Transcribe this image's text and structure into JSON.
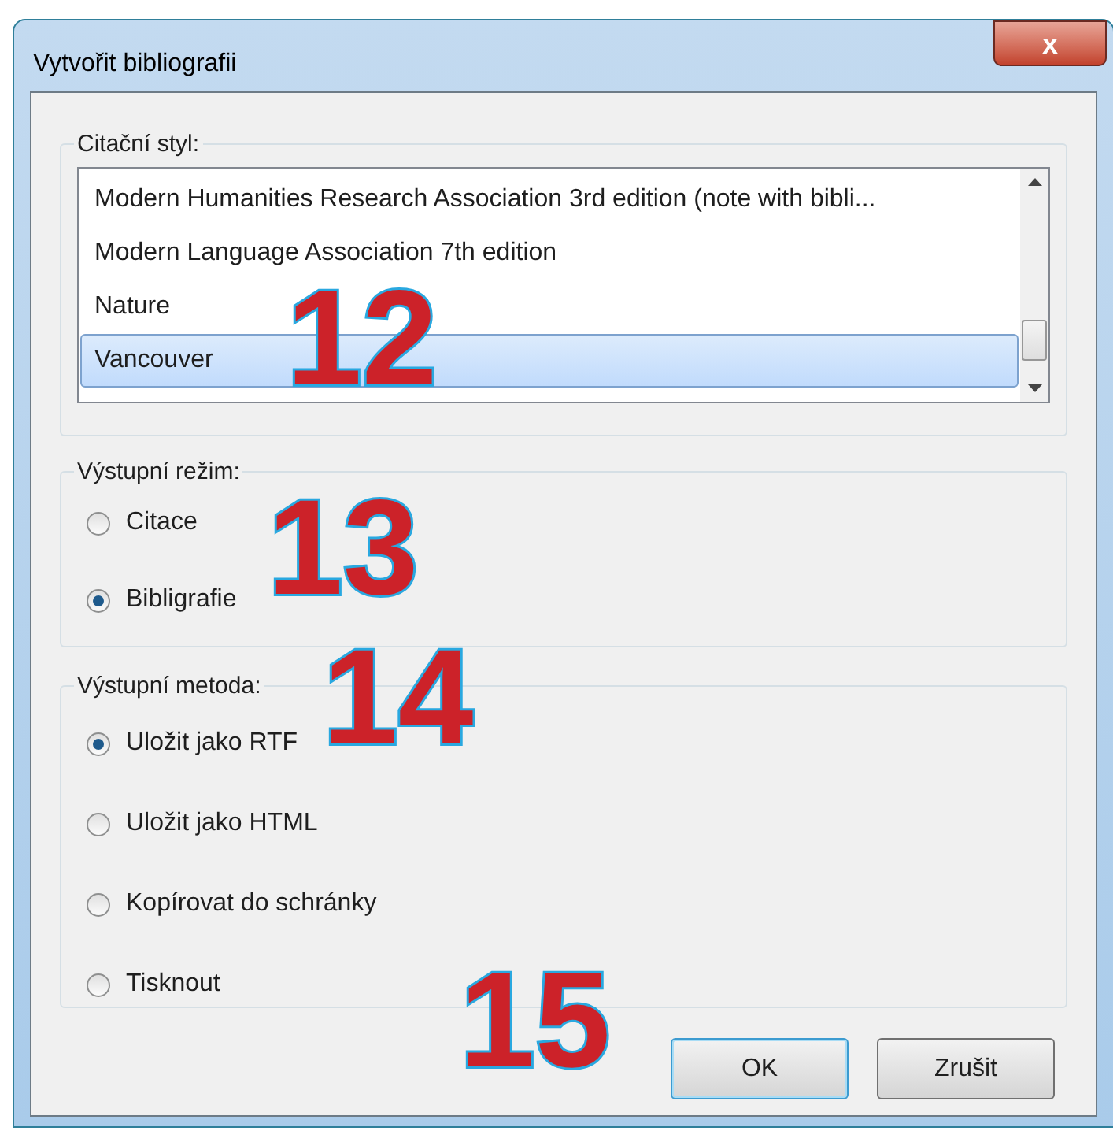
{
  "window": {
    "title": "Vytvořit bibliografii",
    "close": "x"
  },
  "citation_style": {
    "label": "Citační styl:",
    "items": [
      {
        "label": "Modern Humanities Research Association 3rd edition (note with bibli...",
        "selected": false
      },
      {
        "label": "Modern Language Association 7th edition",
        "selected": false
      },
      {
        "label": "Nature",
        "selected": false
      },
      {
        "label": "Vancouver",
        "selected": true
      }
    ]
  },
  "output_mode": {
    "label": "Výstupní režim:",
    "options": [
      {
        "label": "Citace",
        "selected": false
      },
      {
        "label": "Bibligrafie",
        "selected": true
      }
    ]
  },
  "output_method": {
    "label": "Výstupní metoda:",
    "options": [
      {
        "label": "Uložit jako RTF",
        "selected": true
      },
      {
        "label": "Uložit jako HTML",
        "selected": false
      },
      {
        "label": "Kopírovat do schránky",
        "selected": false
      },
      {
        "label": "Tisknout",
        "selected": false
      }
    ]
  },
  "buttons": [
    {
      "label": "OK",
      "default": true
    },
    {
      "label": "Zrušit",
      "default": false
    }
  ],
  "callouts": [
    "12",
    "13",
    "14",
    "15"
  ]
}
